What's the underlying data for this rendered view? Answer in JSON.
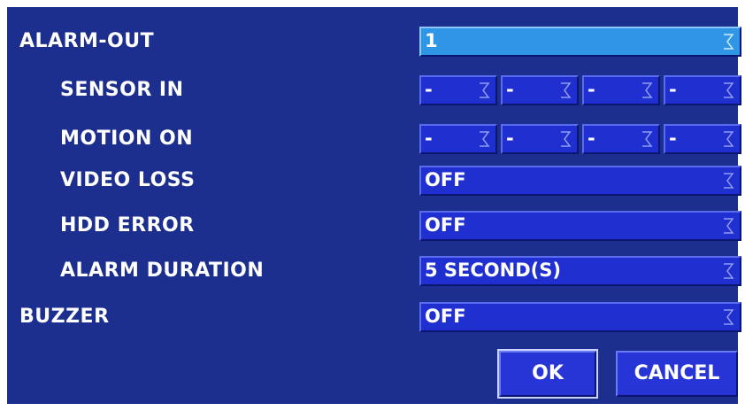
{
  "labels": {
    "alarm_out": "ALARM-OUT",
    "sensor_in": "SENSOR IN",
    "motion_on": "MOTION ON",
    "video_loss": "VIDEO LOSS",
    "hdd_error": "HDD ERROR",
    "alarm_duration": "ALARM DURATION",
    "buzzer": "BUZZER"
  },
  "values": {
    "alarm_out": "1",
    "sensor_in": [
      "-",
      "-",
      "-",
      "-"
    ],
    "motion_on": [
      "-",
      "-",
      "-",
      "-"
    ],
    "video_loss": "OFF",
    "hdd_error": "OFF",
    "alarm_duration": "5 SECOND(S)",
    "buzzer": "OFF"
  },
  "buttons": {
    "ok": "OK",
    "cancel": "CANCEL"
  },
  "icons": {
    "dropdown": "dropdown-arrow-icon"
  },
  "colors": {
    "panel": "#1c2f8e",
    "field": "#1f2fd0",
    "selected_field": "#2f96e6"
  }
}
